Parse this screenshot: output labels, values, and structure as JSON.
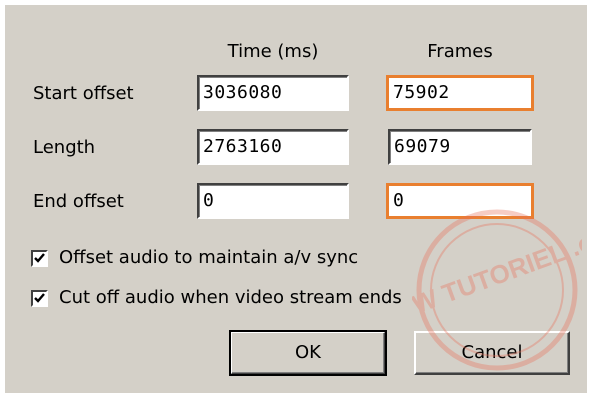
{
  "dialog": {
    "headers": {
      "time": "Time (ms)",
      "frames": "Frames"
    },
    "rows": [
      {
        "label": "Start offset",
        "time": "3036080",
        "frames": "75902"
      },
      {
        "label": "Length",
        "time": "2763160",
        "frames": "69079"
      },
      {
        "label": "End offset",
        "time": "0",
        "frames": "0"
      }
    ],
    "options": [
      {
        "label": "Offset audio to maintain a/v sync",
        "checked": true
      },
      {
        "label": "Cut off audio when video stream ends",
        "checked": true
      }
    ],
    "buttons": {
      "ok": "OK",
      "cancel": "Cancel"
    }
  },
  "watermark": {
    "text": "WWW TUTORIEL .org"
  },
  "colors": {
    "dialog_bg": "#d4d0c8",
    "highlight": "#e97f2f",
    "watermark": "#e8705a"
  }
}
